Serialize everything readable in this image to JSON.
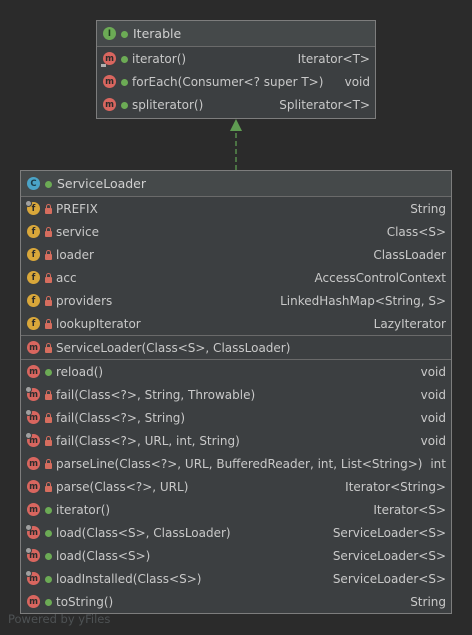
{
  "iterable": {
    "title": "Iterable",
    "kind": "I",
    "methods": [
      {
        "name": "iterator()",
        "type": "Iterator<T>"
      },
      {
        "name": "forEach(Consumer<? super T>)",
        "type": "void"
      },
      {
        "name": "spliterator()",
        "type": "Spliterator<T>"
      }
    ]
  },
  "service_loader": {
    "title": "ServiceLoader",
    "kind": "C",
    "fields": [
      {
        "name": "PREFIX",
        "type": "String"
      },
      {
        "name": "service",
        "type": "Class<S>"
      },
      {
        "name": "loader",
        "type": "ClassLoader"
      },
      {
        "name": "acc",
        "type": "AccessControlContext"
      },
      {
        "name": "providers",
        "type": "LinkedHashMap<String, S>"
      },
      {
        "name": "lookupIterator",
        "type": "LazyIterator"
      }
    ],
    "constructors": [
      {
        "name": "ServiceLoader(Class<S>, ClassLoader)",
        "type": ""
      }
    ],
    "methods": [
      {
        "name": "reload()",
        "type": "void"
      },
      {
        "name": "fail(Class<?>, String, Throwable)",
        "type": "void"
      },
      {
        "name": "fail(Class<?>, String)",
        "type": "void"
      },
      {
        "name": "fail(Class<?>, URL, int, String)",
        "type": "void"
      },
      {
        "name": "parseLine(Class<?>, URL, BufferedReader, int, List<String>)",
        "type": "int"
      },
      {
        "name": "parse(Class<?>, URL)",
        "type": "Iterator<String>"
      },
      {
        "name": "iterator()",
        "type": "Iterator<S>"
      },
      {
        "name": "load(Class<S>, ClassLoader)",
        "type": "ServiceLoader<S>"
      },
      {
        "name": "load(Class<S>)",
        "type": "ServiceLoader<S>"
      },
      {
        "name": "loadInstalled(Class<S>)",
        "type": "ServiceLoader<S>"
      },
      {
        "name": "toString()",
        "type": "String"
      }
    ]
  },
  "watermark": "Powered by yFiles",
  "colors": {
    "background": "#2b2b2b",
    "node": "#3c3f41",
    "arrow": "#5f9c52",
    "method": "#d9665f",
    "field": "#d9a73a",
    "class": "#4aa3c7",
    "interface": "#6cab55"
  }
}
